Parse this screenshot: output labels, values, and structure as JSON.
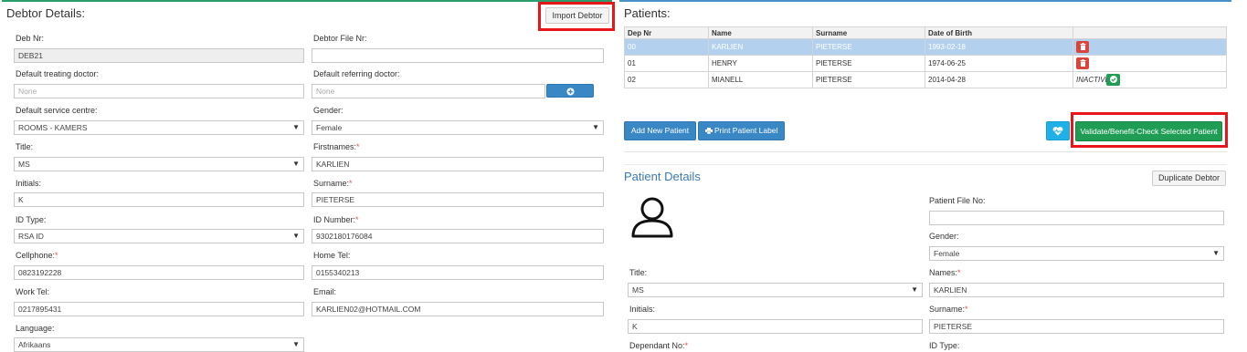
{
  "debtor": {
    "title": "Debtor Details:",
    "import_button": "Import Debtor",
    "deb_nr_label": "Deb Nr:",
    "deb_nr_value": "DEB21",
    "file_nr_label": "Debtor File Nr:",
    "file_nr_value": "",
    "treating_doctor_label": "Default treating doctor:",
    "treating_doctor_placeholder": "None",
    "referring_doctor_label": "Default referring doctor:",
    "referring_doctor_placeholder": "None",
    "service_centre_label": "Default service centre:",
    "service_centre_value": "ROOMS - KAMERS",
    "gender_label": "Gender:",
    "gender_value": "Female",
    "title_label": "Title:",
    "title_value": "MS",
    "firstnames_label": "Firstnames:",
    "firstnames_value": "KARLIEN",
    "initials_label": "Initials:",
    "initials_value": "K",
    "surname_label": "Surname:",
    "surname_value": "PIETERSE",
    "id_type_label": "ID Type:",
    "id_type_value": "RSA ID",
    "id_number_label": "ID Number:",
    "id_number_value": "9302180176084",
    "cellphone_label": "Cellphone:",
    "cellphone_value": "0823192228",
    "home_tel_label": "Home Tel:",
    "home_tel_value": "0155340213",
    "work_tel_label": "Work Tel:",
    "work_tel_value": "0217895431",
    "email_label": "Email:",
    "email_value": "KARLIEN02@HOTMAIL.COM",
    "language_label": "Language:",
    "language_value": "Afrikaans",
    "required_mark": "*"
  },
  "patients": {
    "title": "Patients:",
    "columns": [
      "Dep Nr",
      "Name",
      "Surname",
      "Date of Birth"
    ],
    "rows": [
      {
        "dep": "00",
        "name": "KARLIEN",
        "surname": "PIETERSE",
        "dob": "1993-02-18",
        "status": ""
      },
      {
        "dep": "01",
        "name": "HENRY",
        "surname": "PIETERSE",
        "dob": "1974-06-25",
        "status": ""
      },
      {
        "dep": "02",
        "name": "MIANELL",
        "surname": "PIETERSE",
        "dob": "2014-04-28",
        "status": "INACTIVE"
      }
    ],
    "add_button": "Add New Patient",
    "print_button": "Print Patient Label",
    "validate_button": "Validate/Benefit-Check Selected Patient"
  },
  "patient_details": {
    "title": "Patient Details",
    "duplicate_button": "Duplicate Debtor",
    "file_no_label": "Patient File No:",
    "file_no_value": "",
    "gender_label": "Gender:",
    "gender_value": "Female",
    "title_label": "Title:",
    "title_value": "MS",
    "names_label": "Names:",
    "names_value": "KARLIEN",
    "initials_label": "Initials:",
    "initials_value": "K",
    "surname_label": "Surname:",
    "surname_value": "PIETERSE",
    "dependant_label": "Dependant No:",
    "id_type_label": "ID Type:"
  },
  "icons": {
    "select_arrow": "▼",
    "plus": "plus-icon",
    "trash": "trash-icon",
    "check": "check-icon",
    "printer": "printer-icon",
    "heartbeat": "heartbeat-icon",
    "avatar": "user-avatar-icon"
  },
  "colors": {
    "accent_green": "#2a9d6a",
    "accent_blue": "#3a87c6",
    "highlight_red": "#e8151b",
    "selected_row": "#b3d1ee"
  }
}
